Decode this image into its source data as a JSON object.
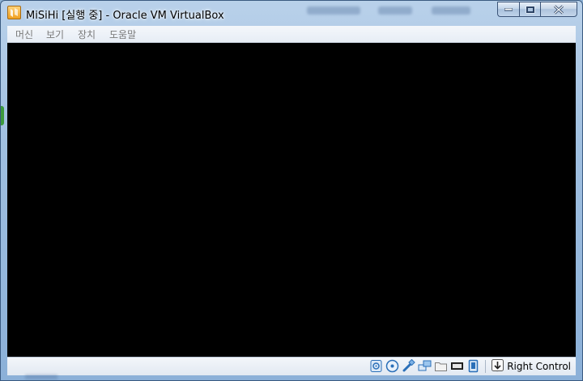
{
  "window": {
    "title": "MiSiHi [실행 중] - Oracle VM VirtualBox"
  },
  "menubar": {
    "items": [
      "머신",
      "보기",
      "장치",
      "도움말"
    ]
  },
  "statusbar": {
    "host_key": "Right Control",
    "icons": [
      "hard-disk-icon",
      "optical-drive-icon",
      "usb-icon",
      "network-icon",
      "shared-folders-icon",
      "display-icon",
      "video-capture-icon",
      "mouse-integration-icon",
      "host-key-arrow-icon"
    ]
  },
  "colors": {
    "screen": "#000000",
    "frame": "#9fbfe0",
    "accent": "#1e72c8"
  }
}
